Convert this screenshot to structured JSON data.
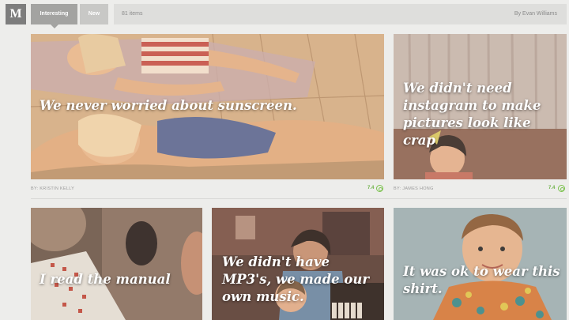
{
  "header": {
    "logo": "M",
    "tabs": [
      {
        "label": "Interesting",
        "active": true
      },
      {
        "label": "New",
        "active": false
      }
    ],
    "item_count": "81 items",
    "author": "By Evan Williams"
  },
  "cards": [
    {
      "caption": "We never worried about sunscreen.",
      "byline": "BY: KRISTIN KELLY",
      "score": "7.4"
    },
    {
      "caption": "We didn't need instagram to make pictures look like crap",
      "byline": "BY: JAMES HONG",
      "score": "7.4"
    },
    {
      "caption": "I read the manual"
    },
    {
      "caption": "We didn't have MP3's, we made our own music."
    },
    {
      "caption": "It was ok to wear this shirt."
    }
  ],
  "colors": {
    "score_green": "#7cc24f",
    "tab_active": "#a3a3a1",
    "tab_inactive": "#c8c8c6"
  }
}
